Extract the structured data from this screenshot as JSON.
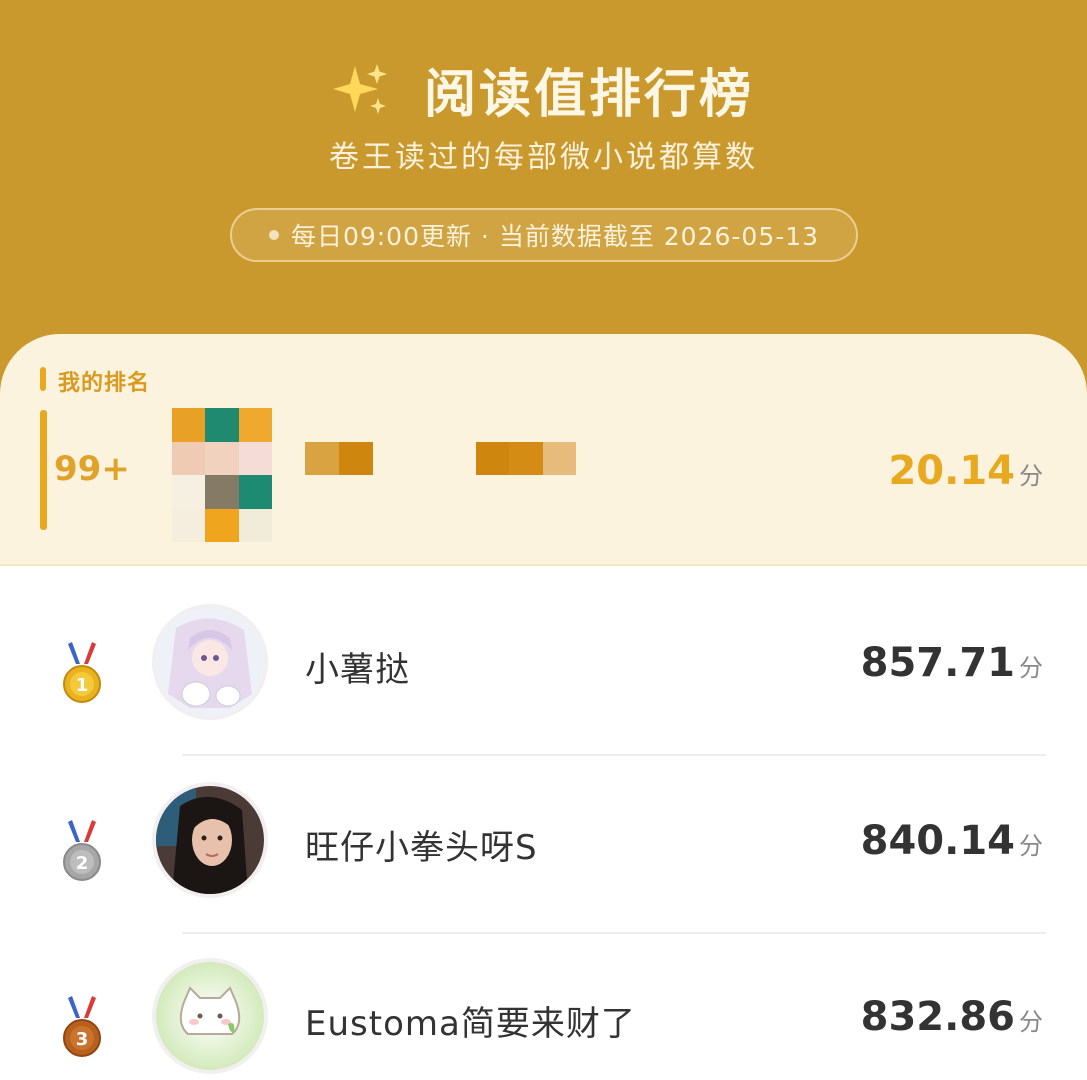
{
  "header": {
    "title": "阅读值排行榜",
    "subtitle": "卷王读过的每部微小说都算数",
    "update_note": "每日09:00更新 · 当前数据截至 2026-05-13",
    "background_color": "#c9992d"
  },
  "my_rank": {
    "label": "我的排名",
    "rank": "99+",
    "score": "20.14",
    "unit": "分",
    "accent_color": "#e8a820"
  },
  "leaderboard": [
    {
      "rank": 1,
      "medal_icon": "gold-medal-icon",
      "name": "小薯挞",
      "score": "857.71",
      "unit": "分"
    },
    {
      "rank": 2,
      "medal_icon": "silver-medal-icon",
      "name": "旺仔小拳头呀S",
      "score": "840.14",
      "unit": "分"
    },
    {
      "rank": 3,
      "medal_icon": "bronze-medal-icon",
      "name": "Eustoma简要来财了",
      "score": "832.86",
      "unit": "分"
    }
  ]
}
